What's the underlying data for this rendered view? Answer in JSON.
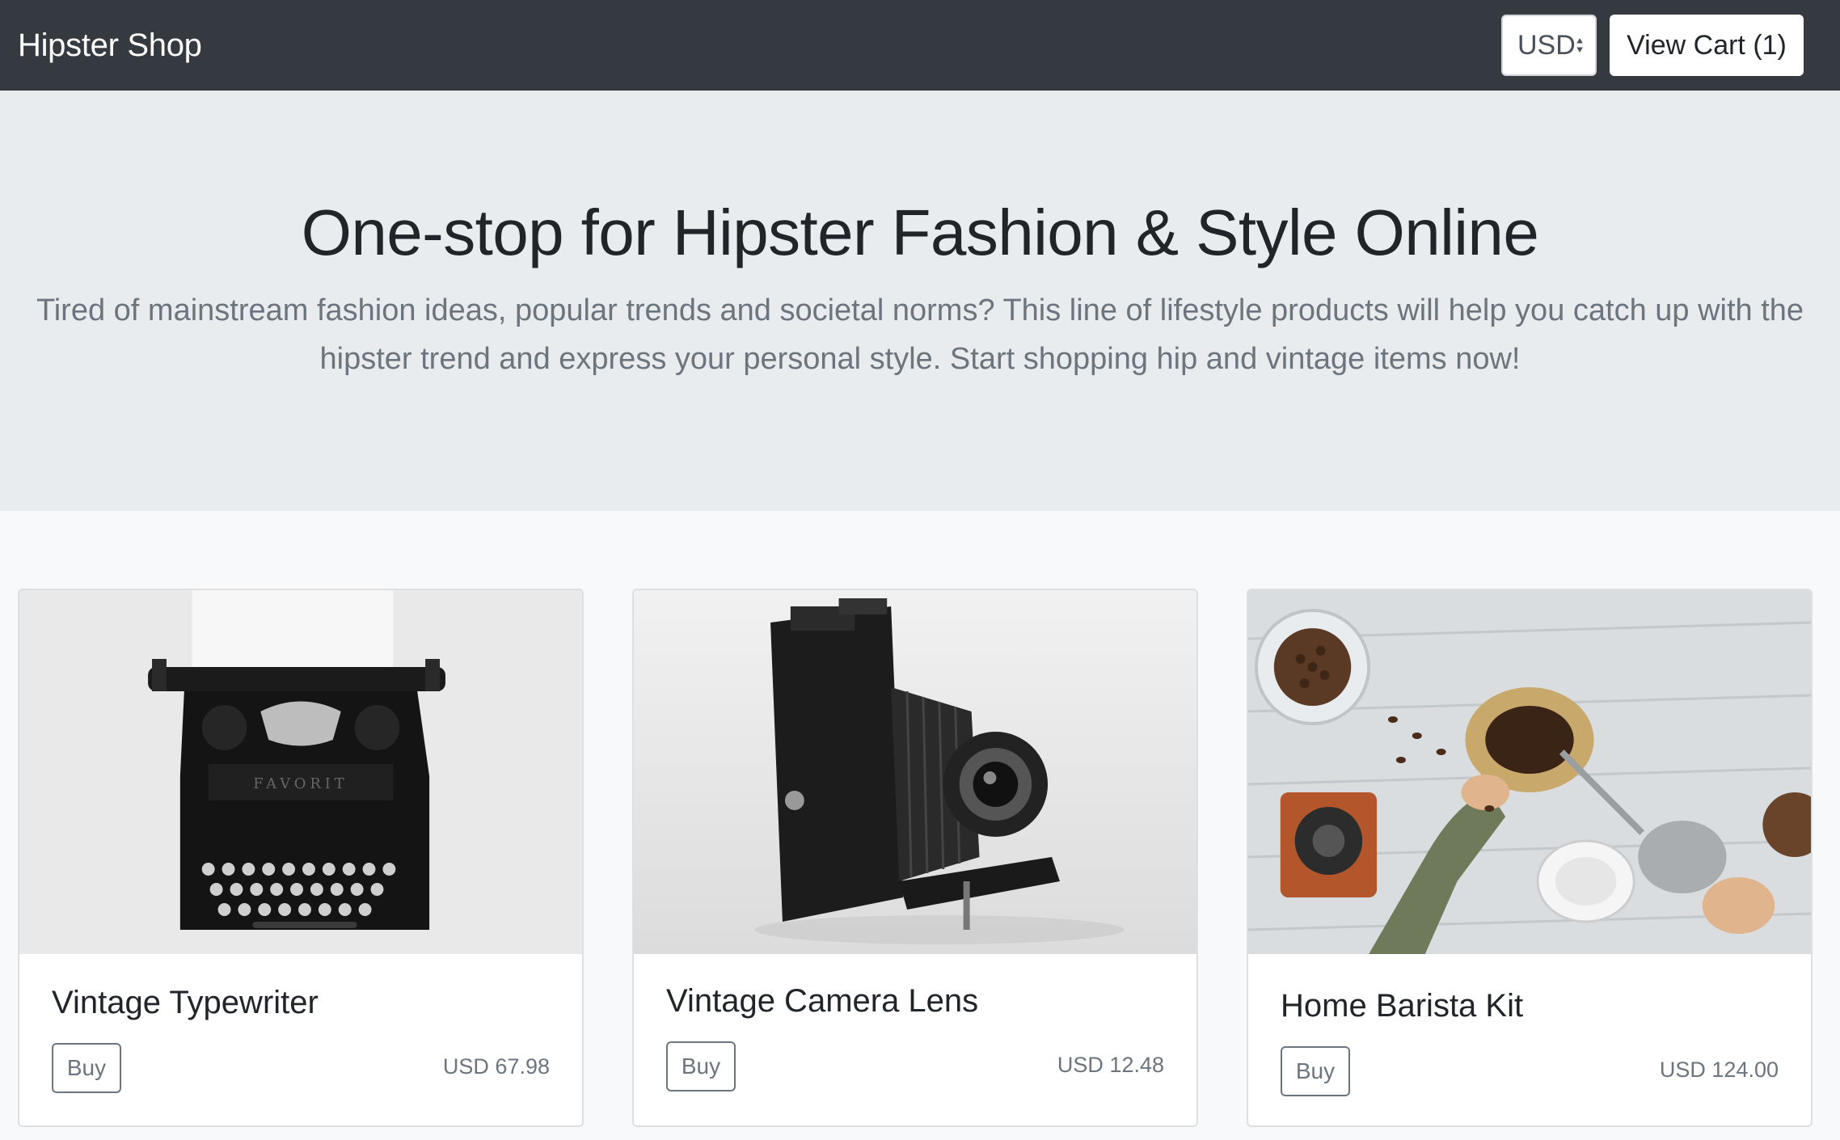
{
  "navbar": {
    "brand": "Hipster Shop",
    "currency": {
      "selected": "USD",
      "icon": "sort-arrows-icon"
    },
    "cart_button": "View Cart (1)"
  },
  "hero": {
    "title": "One-stop for Hipster Fashion & Style Online",
    "subtitle": "Tired of mainstream fashion ideas, popular trends and societal norms? This line of lifestyle products will help you catch up with the hipster trend and express your personal style. Start shopping hip and vintage items now!"
  },
  "products": [
    {
      "name": "Vintage Typewriter",
      "buy_label": "Buy",
      "price": "USD 67.98",
      "image": "typewriter-image"
    },
    {
      "name": "Vintage Camera Lens",
      "buy_label": "Buy",
      "price": "USD 12.48",
      "image": "camera-image"
    },
    {
      "name": "Home Barista Kit",
      "buy_label": "Buy",
      "price": "USD 124.00",
      "image": "barista-kit-image"
    }
  ],
  "colors": {
    "navbar_bg": "#343a40",
    "hero_bg": "#e9ecef",
    "page_bg": "#f8f9fa",
    "muted_text": "#6c757d"
  }
}
